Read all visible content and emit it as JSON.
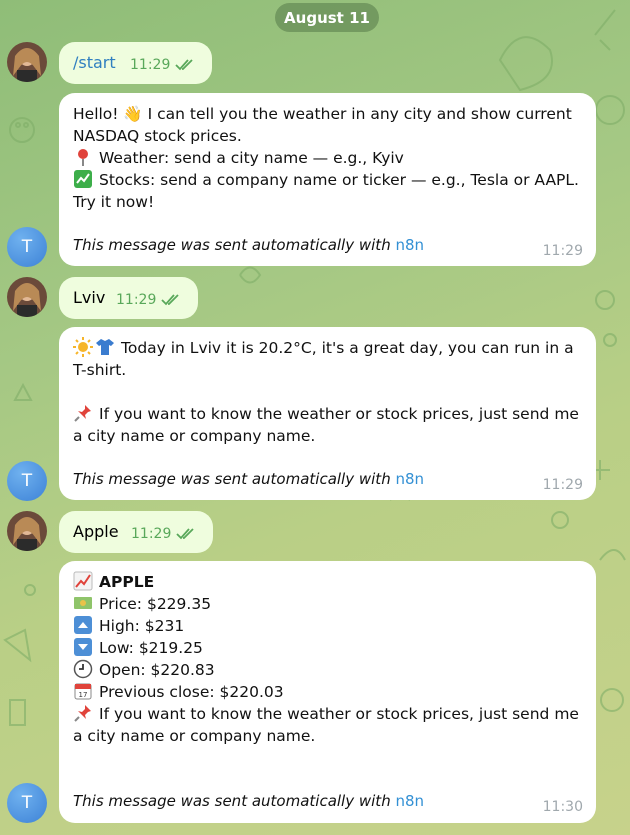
{
  "date_chip": "August 11",
  "avatar_bot_letter": "T",
  "messages": [
    {
      "from": "user",
      "text": "/start",
      "time": "11:29"
    },
    {
      "from": "bot",
      "lines": [
        "Hello! 👋 I can tell you the weather in any city and show current NASDAQ stock prices.",
        "Weather: send a city name — e.g., Kyiv",
        "Stocks: send a company name or ticker — e.g., Tesla or AAPL.",
        "Try it now!"
      ],
      "footer": "This message was sent automatically with ",
      "footer_link": "n8n",
      "time": "11:29"
    },
    {
      "from": "user",
      "text": "Lviv",
      "time": "11:29"
    },
    {
      "from": "bot",
      "lines": [
        "Today in Lviv it is 20.2°C, it's a great day, you can run in a T-shirt.",
        "If you want to know the weather or stock prices, just send me a city name or company name."
      ],
      "footer": "This message was sent automatically with ",
      "footer_link": "n8n",
      "time": "11:29"
    },
    {
      "from": "user",
      "text": "Apple",
      "time": "11:29"
    },
    {
      "from": "bot",
      "title": "APPLE",
      "lines": [
        "Price: $229.35",
        "High: $231",
        "Low: $219.25",
        "Open: $220.83",
        "Previous close: $220.03",
        "If you want to know the weather or stock prices, just send me a city name or company name."
      ],
      "footer": "This message was sent automatically with ",
      "footer_link": "n8n",
      "time": "11:30"
    }
  ],
  "icons": [
    "wave-hand",
    "pin",
    "chart-exchange",
    "sun",
    "t-shirt",
    "pushpin",
    "chart-up",
    "money",
    "arrow-up",
    "arrow-down",
    "clock",
    "calendar",
    "double-check"
  ],
  "colors": {
    "outgoing_bubble": "#effdde",
    "incoming_bubble": "#ffffff",
    "check": "#59a85a",
    "link": "#3390d4",
    "bot_avatar": "#4a8fe0"
  }
}
